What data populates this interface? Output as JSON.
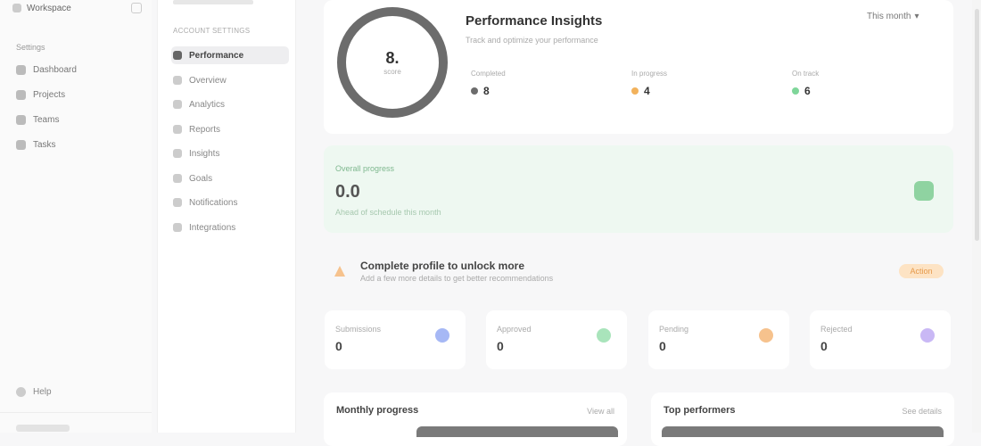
{
  "sidebar": {
    "workspace": "Workspace",
    "section": "Settings",
    "items": [
      {
        "label": "Dashboard",
        "icon": "grid-icon"
      },
      {
        "label": "Projects",
        "icon": "folder-icon"
      },
      {
        "label": "Teams",
        "icon": "users-icon"
      },
      {
        "label": "Tasks",
        "icon": "list-icon"
      }
    ],
    "footer": "Help"
  },
  "settings_nav": {
    "section": "ACCOUNT SETTINGS",
    "items": [
      {
        "label": "Performance",
        "active": true
      },
      {
        "label": "Overview",
        "active": false
      },
      {
        "label": "Analytics",
        "active": false
      },
      {
        "label": "Reports",
        "active": false
      },
      {
        "label": "Insights",
        "active": false
      },
      {
        "label": "Goals",
        "active": false
      },
      {
        "label": "Notifications",
        "active": false
      },
      {
        "label": "Integrations",
        "active": false
      }
    ]
  },
  "hero": {
    "score": "8.",
    "score_caption": "score",
    "title": "Performance Insights",
    "subtitle": "Track and optimize your performance",
    "menu": "This month",
    "stats": [
      {
        "label": "Completed",
        "value": "8",
        "color": "#6c6c6c"
      },
      {
        "label": "In progress",
        "value": "4",
        "color": "#f2b25c"
      },
      {
        "label": "On track",
        "value": "6",
        "color": "#7fd69a"
      }
    ]
  },
  "highlight": {
    "label": "Overall progress",
    "value": "0.0",
    "subtitle": "Ahead of schedule this month"
  },
  "warning": {
    "title": "Complete profile to unlock more",
    "subtitle": "Add a few more details to get better recommendations",
    "pill": "Action"
  },
  "mini_cards": [
    {
      "label": "Submissions",
      "value": "0",
      "color": "#a6b8f5"
    },
    {
      "label": "Approved",
      "value": "0",
      "color": "#a9e4bb"
    },
    {
      "label": "Pending",
      "value": "0",
      "color": "#f6c28d"
    },
    {
      "label": "Rejected",
      "value": "0",
      "color": "#c9b8f5"
    }
  ],
  "bottom": [
    {
      "title": "Monthly progress",
      "right": "View all"
    },
    {
      "title": "Top performers",
      "right": "See details"
    }
  ]
}
